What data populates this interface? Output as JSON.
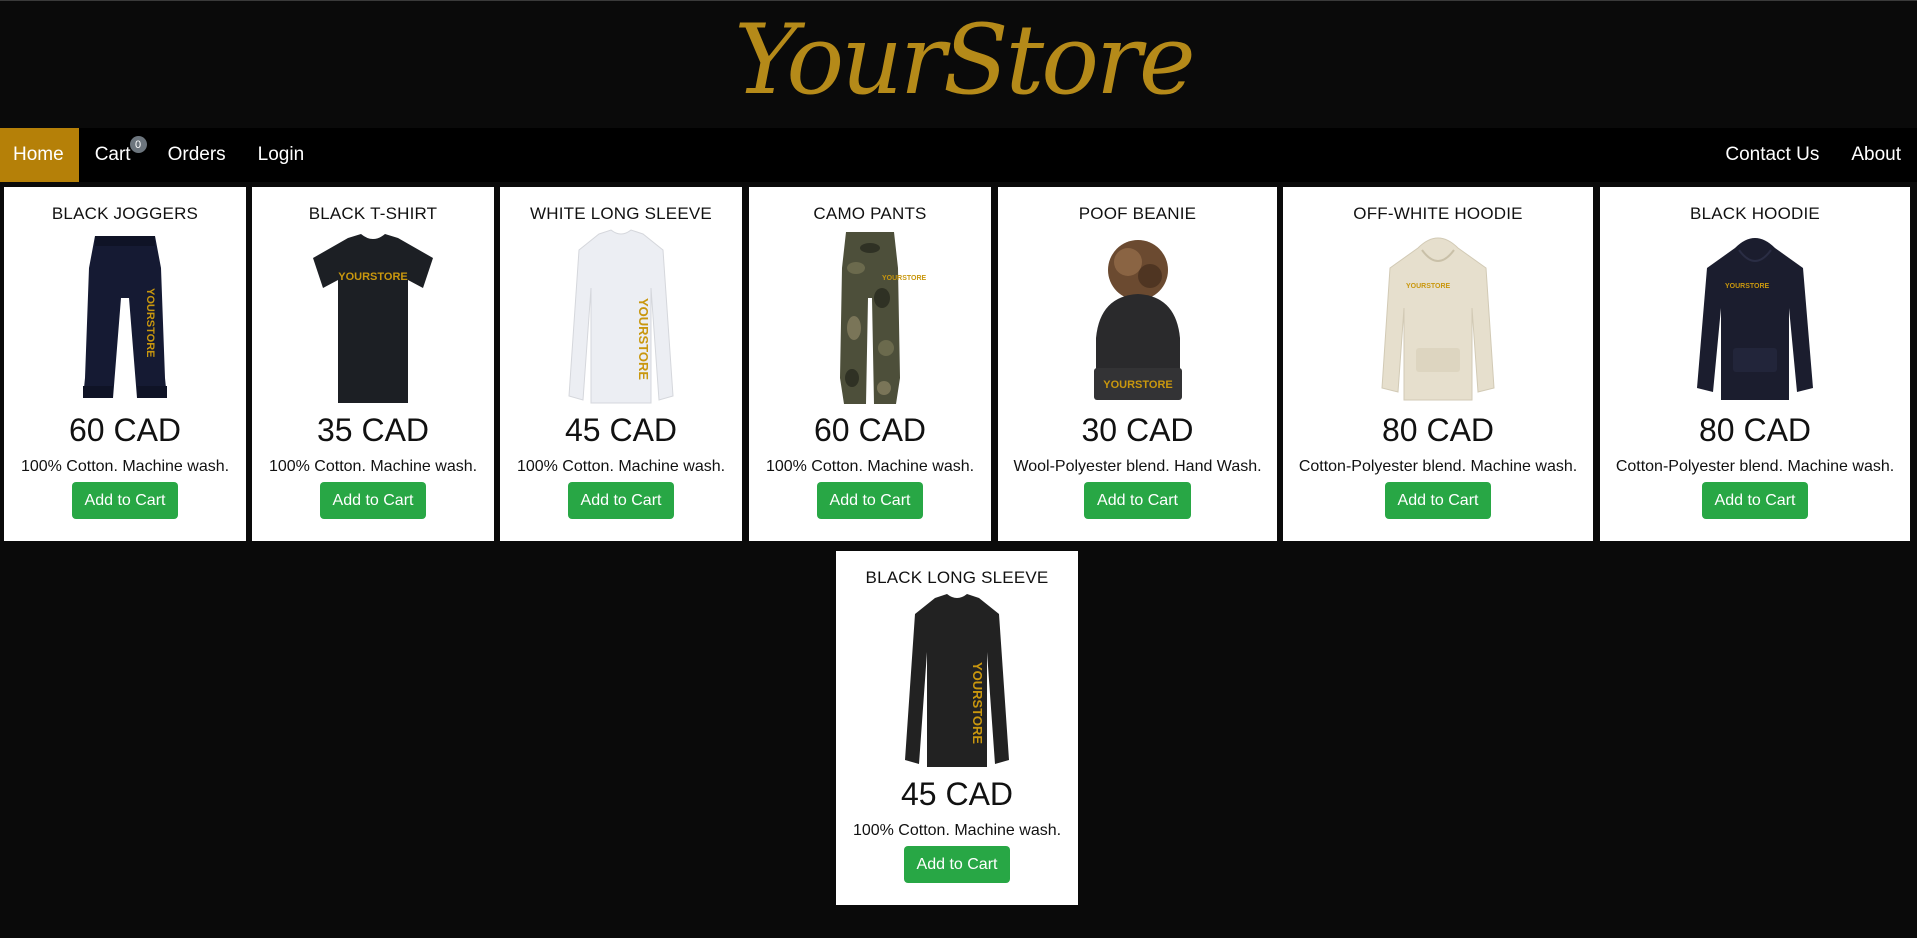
{
  "brand": {
    "logo_text": "YourStore",
    "accent": "#b58008",
    "logo_color": "#b58a19"
  },
  "nav": {
    "left": [
      {
        "label": "Home",
        "active": true
      },
      {
        "label": "Cart",
        "badge": "0"
      },
      {
        "label": "Orders"
      },
      {
        "label": "Login"
      }
    ],
    "right": [
      {
        "label": "Contact Us"
      },
      {
        "label": "About"
      }
    ]
  },
  "products": [
    {
      "name": "BLACK JOGGERS",
      "price": "60 CAD",
      "desc": "100% Cotton. Machine wash.",
      "button": "Add to Cart",
      "image": "black-joggers-image",
      "color": "#151a33"
    },
    {
      "name": "BLACK T-SHIRT",
      "price": "35 CAD",
      "desc": "100% Cotton. Machine wash.",
      "button": "Add to Cart",
      "image": "black-tshirt-image",
      "color": "#1c1f24"
    },
    {
      "name": "WHITE LONG SLEEVE",
      "price": "45 CAD",
      "desc": "100% Cotton. Machine wash.",
      "button": "Add to Cart",
      "image": "white-long-sleeve-image",
      "color": "#eceef3"
    },
    {
      "name": "CAMO PANTS",
      "price": "60 CAD",
      "desc": "100% Cotton. Machine wash.",
      "button": "Add to Cart",
      "image": "camo-pants-image",
      "color": "#4d4f3a"
    },
    {
      "name": "POOF BEANIE",
      "price": "30 CAD",
      "desc": "Wool-Polyester blend. Hand Wash.",
      "button": "Add to Cart",
      "image": "poof-beanie-image",
      "color": "#2a2a2c"
    },
    {
      "name": "OFF-WHITE HOODIE",
      "price": "80 CAD",
      "desc": "Cotton-Polyester blend. Machine wash.",
      "button": "Add to Cart",
      "image": "off-white-hoodie-image",
      "color": "#e6dfcd"
    },
    {
      "name": "BLACK HOODIE",
      "price": "80 CAD",
      "desc": "Cotton-Polyester blend. Machine wash.",
      "button": "Add to Cart",
      "image": "black-hoodie-image",
      "color": "#1b1d2e"
    },
    {
      "name": "BLACK LONG SLEEVE",
      "price": "45 CAD",
      "desc": "100% Cotton. Machine wash.",
      "button": "Add to Cart",
      "image": "black-long-sleeve-image",
      "color": "#222222"
    }
  ],
  "print_text": "YOURSTORE",
  "print_color": "#c9970e"
}
